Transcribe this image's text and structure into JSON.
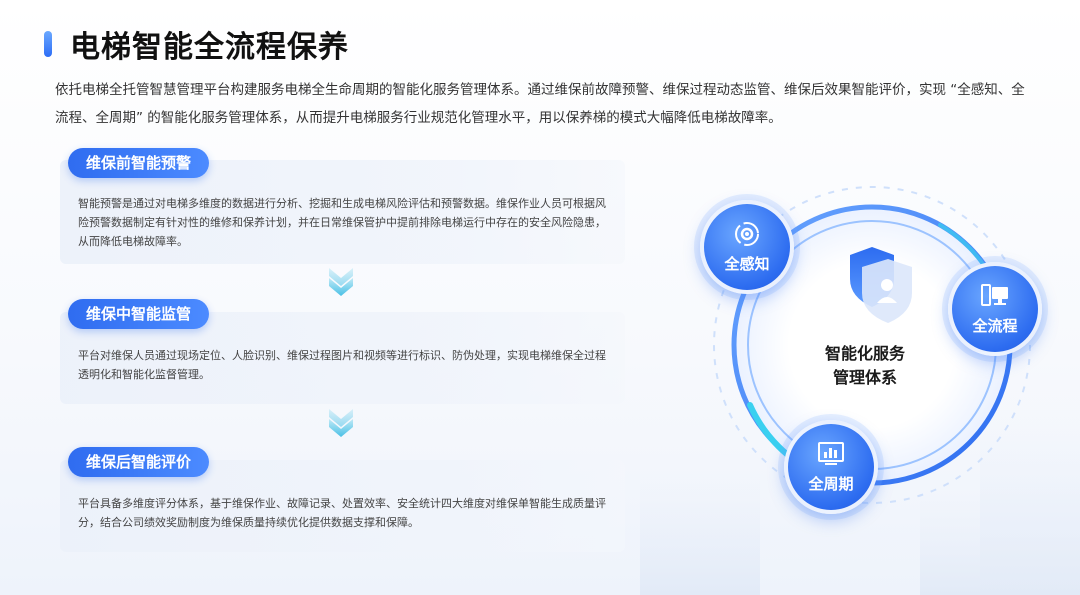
{
  "page": {
    "title": "电梯智能全流程保养",
    "intro": "依托电梯全托管智慧管理平台构建服务电梯全生命周期的智能化服务管理体系。通过维保前故障预警、维保过程动态监管、维保后效果智能评价，实现 “全感知、全流程、全周期” 的智能化服务管理体系，从而提升电梯服务行业规范化管理水平，用以保养梯的模式大幅降低电梯故障率。"
  },
  "sections": [
    {
      "label": "维保前智能预警",
      "text": "智能预警是通过对电梯多维度的数据进行分析、挖掘和生成电梯风险评估和预警数据。维保作业人员可根据风险预警数据制定有针对性的维修和保养计划，并在日常维保管护中提前排除电梯运行中存在的安全风险隐患，从而降低电梯故障率。"
    },
    {
      "label": "维保中智能监管",
      "text": "平台对维保人员通过现场定位、人脸识别、维保过程图片和视频等进行标识、防伪处理，实现电梯维保全过程透明化和智能化监督管理。"
    },
    {
      "label": "维保后智能评价",
      "text": "平台具备多维度评分体系，基于维保作业、故障记录、处置效率、安全统计四大维度对维保单智能生成质量评分，结合公司绩效奖励制度为维保质量持续优化提供数据支撑和保障。"
    }
  ],
  "diagram": {
    "center_line1": "智能化服务",
    "center_line2": "管理体系",
    "nodes": [
      {
        "label": "全感知",
        "icon": "gear-cycle-icon"
      },
      {
        "label": "全流程",
        "icon": "computer-icon"
      },
      {
        "label": "全周期",
        "icon": "chart-icon"
      }
    ]
  },
  "colors": {
    "accent": "#2f6cf0",
    "accent_light": "#4c8bff",
    "arrow": "#5cc8e8"
  }
}
